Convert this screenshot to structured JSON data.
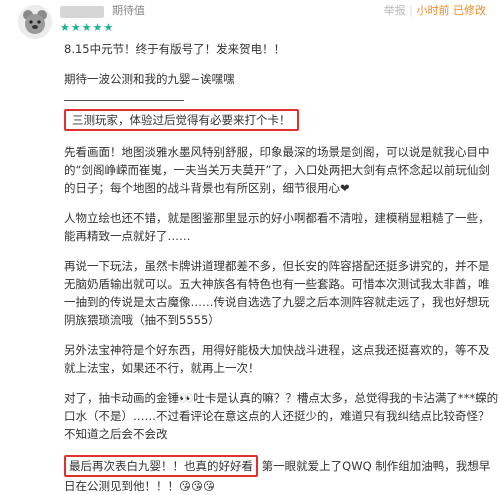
{
  "header": {
    "rating_label": "期待值",
    "stars": "★★★★★",
    "meta_left": "举报",
    "meta_sep": "|",
    "time": "小时前 已修改"
  },
  "post": {
    "line1": "8.15中元节！终于有版号了！发来贺电！！",
    "line2": "期待一波公测和我的九婴~诶嘿嘿",
    "boxed1": "三测玩家，体验过后觉得有必要来打个卡！",
    "para1": "先看画面！地图淡雅水墨风特别舒服，印象最深的场景是剑阁，可以说是就我心目中的“剑阁峥嵘而崔嵬，一夫当关万夫莫开”了，入口处两把大剑有点怀念起以前玩仙剑的日子；每个地图的战斗背景也有所区别，细节很用心❤",
    "para2": "人物立绘也还不错，就是图鉴那里显示的好小啊都看不清啦，建模稍显粗糙了一些，能再精致一点就好了……",
    "para3": "再说一下玩法，虽然卡牌讲道理都差不多，但长安的阵容搭配还挺多讲究的，并不是无脑奶盾输出就可以。五大神族各有特色也有一些套路。可惜本次测试我太非酋，唯一抽到的传说是太古魔像……传说自选选了九婴之后本测阵容就走远了，我也好想玩阴族猥琐流哦（抽不到5555）",
    "para4": "另外法宝神符是个好东西，用得好能极大加快战斗进程，这点我还挺喜欢的，等不及就上法宝，如果还不行，就再上一次！",
    "para5": "对了，抽卡动画的金锤👀吐卡是认真的嘛？？槽点太多，总觉得我的卡沾满了***蝾的口水（不是）……不过看评论在意这点的人还挺少的，难道只有我纠结点比较奇怪？不知道之后会不会改",
    "boxed2": "最后再次表白九婴！！也真的好好看",
    "para6_rest": "第一眼就爱上了QWQ 制作组加油鸭，我想早日在公测见到他！！！😘😘😘"
  }
}
